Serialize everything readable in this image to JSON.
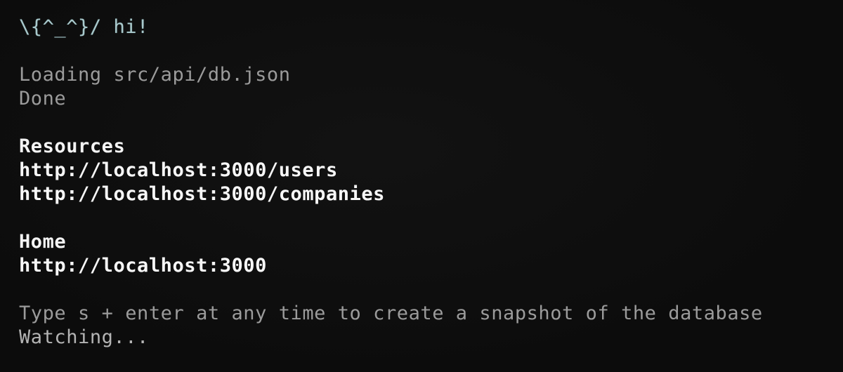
{
  "terminal": {
    "background_color": "#0c0c0c",
    "greeting_color": "#a9c9cc",
    "dim_text_color": "#9b9b9b",
    "bright_text_color": "#f7f7f7",
    "lines": [
      {
        "id": "greeting",
        "style": "greeting",
        "text": "\\{^_^}/ hi!"
      },
      {
        "id": "spacer-1",
        "style": "blank",
        "text": ""
      },
      {
        "id": "loading-db",
        "style": "dim",
        "text": "Loading src/api/db.json"
      },
      {
        "id": "loading-done",
        "style": "dim",
        "text": "Done"
      },
      {
        "id": "spacer-2",
        "style": "blank",
        "text": ""
      },
      {
        "id": "resources-heading",
        "style": "heading",
        "text": "Resources"
      },
      {
        "id": "resource-users",
        "style": "url",
        "text": "http://localhost:3000/users"
      },
      {
        "id": "resource-companies",
        "style": "url",
        "text": "http://localhost:3000/companies"
      },
      {
        "id": "spacer-3",
        "style": "blank",
        "text": ""
      },
      {
        "id": "home-heading",
        "style": "heading",
        "text": "Home"
      },
      {
        "id": "home-url",
        "style": "url",
        "text": "http://localhost:3000"
      },
      {
        "id": "spacer-4",
        "style": "blank",
        "text": ""
      },
      {
        "id": "snapshot-hint",
        "style": "hint",
        "text": "Type s + enter at any time to create a snapshot of the database"
      },
      {
        "id": "watching-status",
        "style": "status",
        "text": "Watching..."
      }
    ]
  }
}
